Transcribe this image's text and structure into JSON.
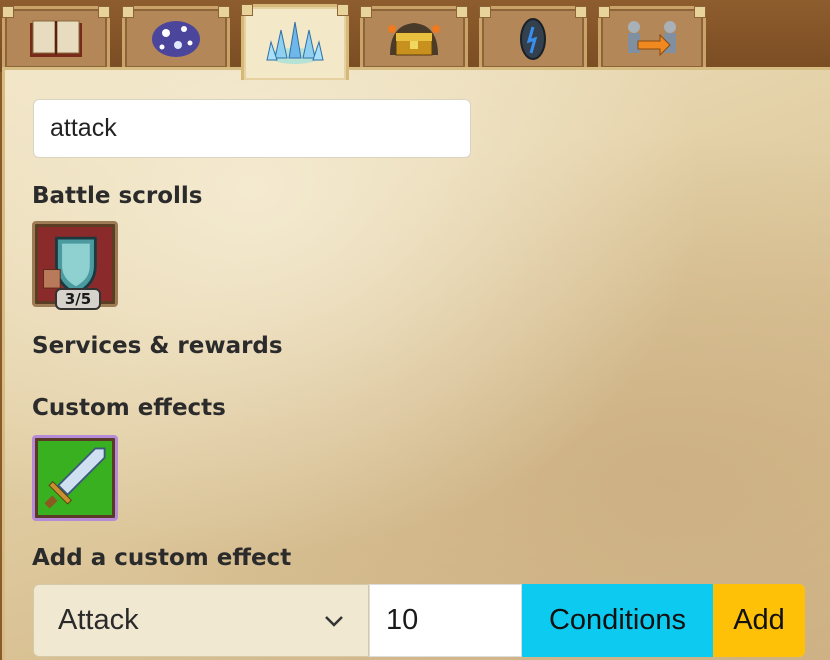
{
  "tabs": [
    {
      "icon": "book-icon",
      "active": false
    },
    {
      "icon": "sparkles-icon",
      "active": false
    },
    {
      "icon": "crystals-icon",
      "active": true
    },
    {
      "icon": "treasure-chest-icon",
      "active": false
    },
    {
      "icon": "rune-stone-icon",
      "active": false
    },
    {
      "icon": "knights-transfer-icon",
      "active": false
    }
  ],
  "search": {
    "value": "attack"
  },
  "sections": {
    "battle_scrolls": "Battle scrolls",
    "services_rewards": "Services & rewards",
    "custom_effects": "Custom effects",
    "add_custom_effect": "Add a custom effect"
  },
  "battle_scroll": {
    "icon": "shield-scroll-icon",
    "badge": "3/5"
  },
  "custom_effect": {
    "icon": "sword-icon"
  },
  "form": {
    "effect_select": "Attack",
    "value": "10",
    "conditions_label": "Conditions",
    "add_label": "Add"
  },
  "colors": {
    "conditions_button": "#0dcaf0",
    "add_button": "#ffc107",
    "effect_slot_border": "#b58bd8"
  }
}
